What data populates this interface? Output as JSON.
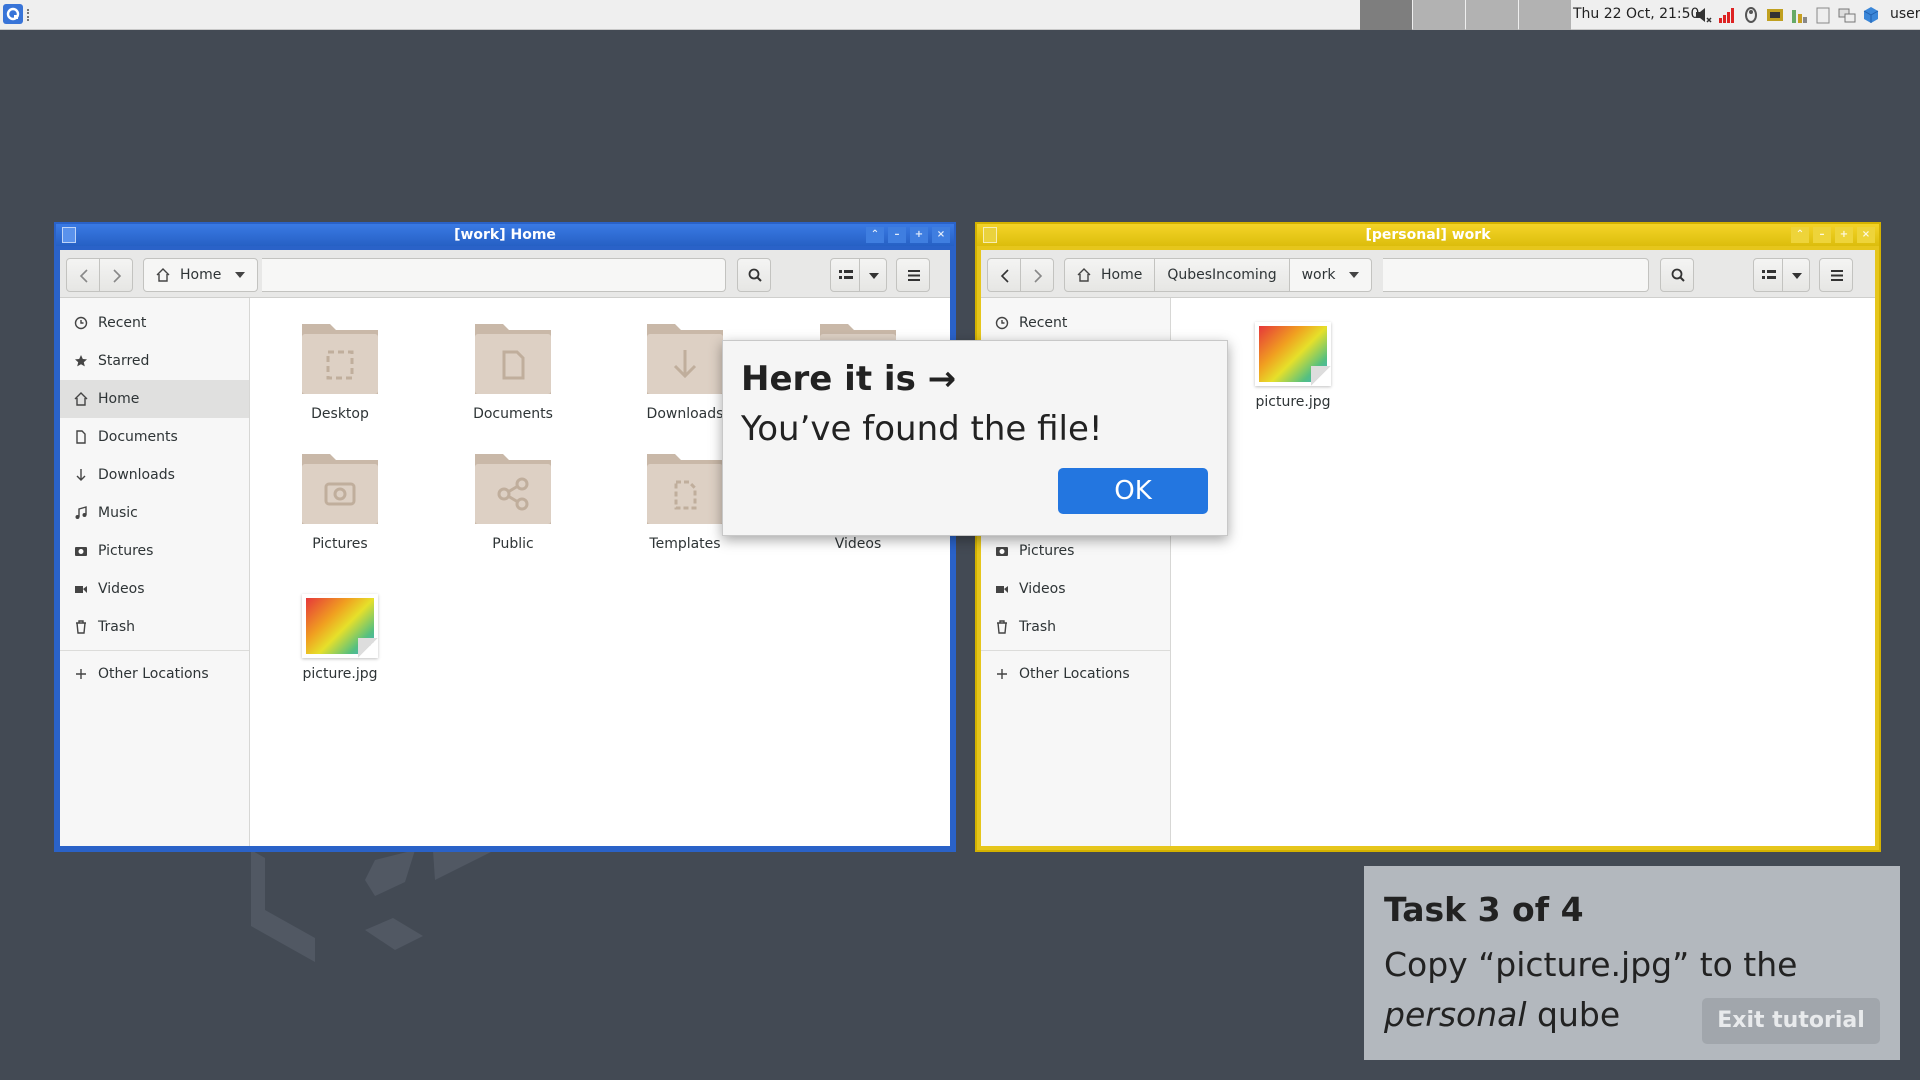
{
  "taskbar": {
    "clock": "Thu 22 Oct, 21:50",
    "user": "user"
  },
  "work_window": {
    "title": "[work] Home",
    "path": [
      "Home"
    ],
    "sidebar": [
      "Recent",
      "Starred",
      "Home",
      "Documents",
      "Downloads",
      "Music",
      "Pictures",
      "Videos",
      "Trash"
    ],
    "other_locations": "Other Locations",
    "files": [
      "Desktop",
      "Documents",
      "Downloads",
      "Pictures",
      "Public",
      "Templates",
      "Videos",
      "picture.jpg"
    ]
  },
  "personal_window": {
    "title": "[personal] work",
    "path": [
      "Home",
      "QubesIncoming",
      "work"
    ],
    "sidebar": [
      "Recent",
      "Pictures",
      "Videos",
      "Trash"
    ],
    "other_locations": "Other Locations",
    "files": [
      "picture.jpg"
    ]
  },
  "popup": {
    "heading": "Here it is →",
    "message": "You’ve found the file!",
    "ok_label": "OK"
  },
  "task": {
    "heading": "Task 3 of 4",
    "line_prefix": "Copy “picture.jpg” to the",
    "emph": "personal",
    "line_suffix": " qube",
    "exit_label": "Exit tutorial"
  },
  "colors": {
    "work_border": "#2a62c8",
    "personal_border": "#e6c61c",
    "accent": "#2376e0"
  }
}
